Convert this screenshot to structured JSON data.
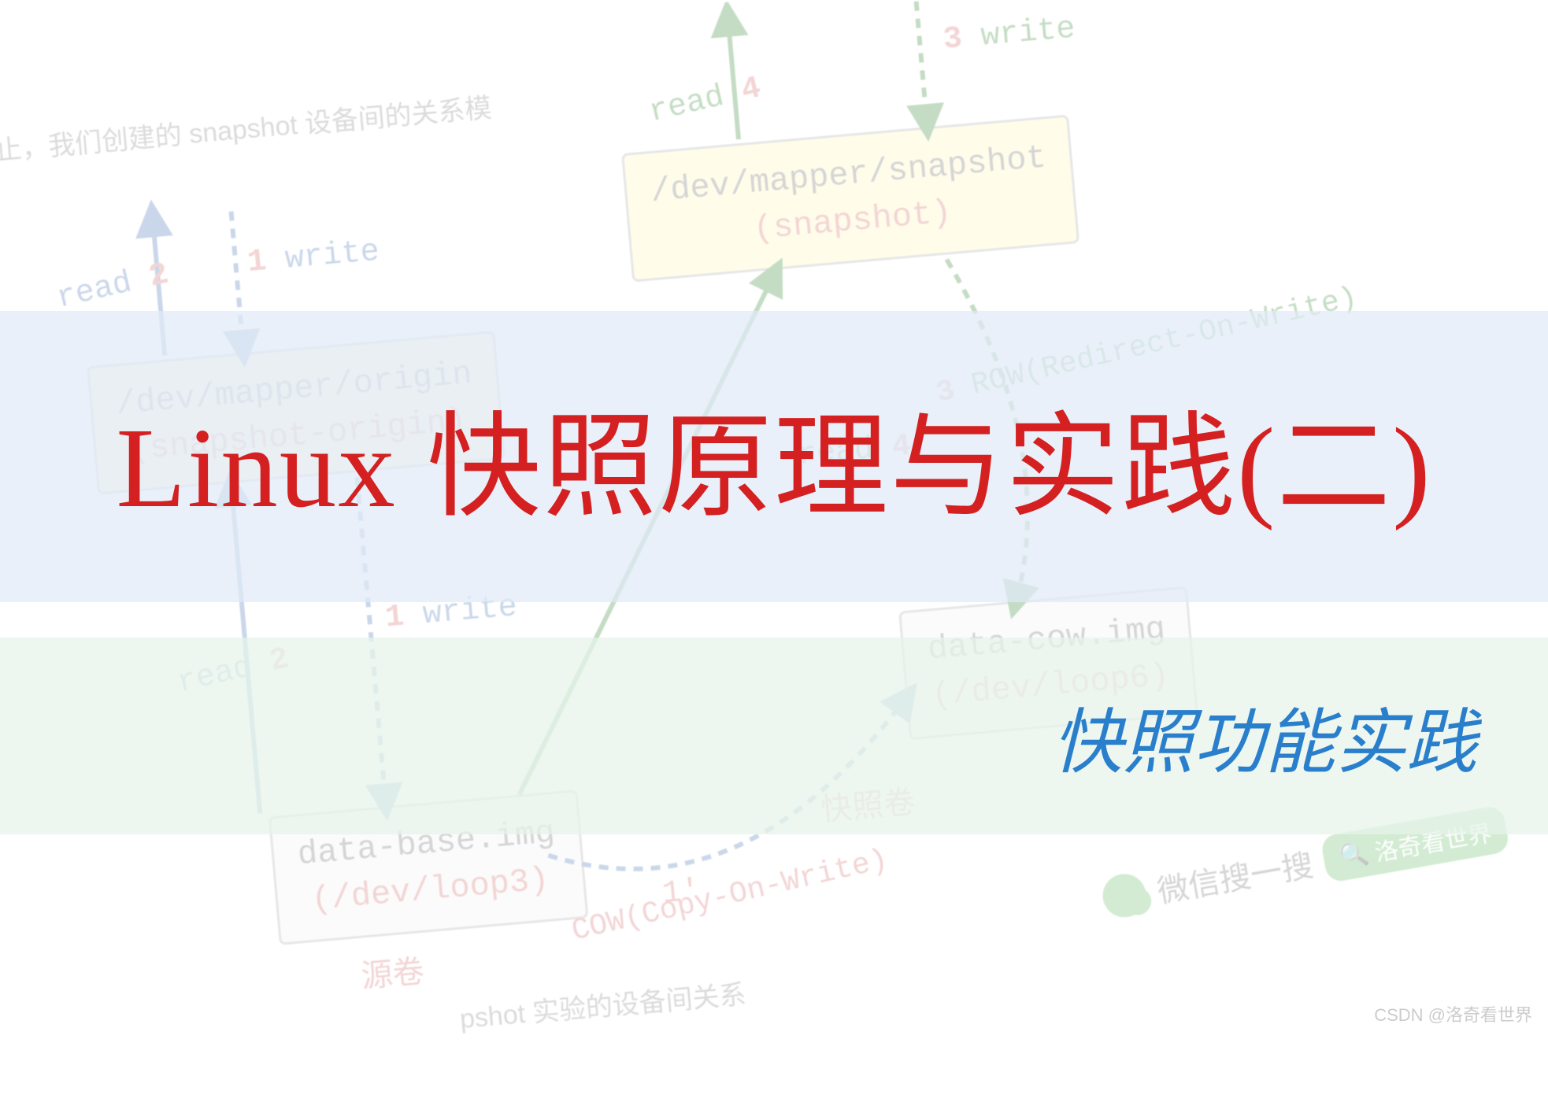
{
  "title": "Linux 快照原理与实践(二)",
  "subtitle": "快照功能实践",
  "caption_top": "此为止，我们创建的 snapshot 设备间的关系模",
  "caption_bottom": "pshot 实验的设备间关系",
  "watermark": "CSDN @洛奇看世界",
  "boxes": {
    "origin": {
      "path": "/dev/mapper/origin",
      "type": "(snapshot-origin)"
    },
    "snapshot": {
      "path": "/dev/mapper/snapshot",
      "type": "(snapshot)"
    },
    "base": {
      "path": "data-base.img",
      "type": "(/dev/loop3)"
    },
    "cow": {
      "path": "data-cow.img",
      "type": "(/dev/loop6)"
    }
  },
  "arrows": {
    "left_top_read": "read",
    "left_top_read_num": "2",
    "left_top_write": "write",
    "left_top_write_num": "1",
    "right_top_read": "read",
    "right_top_read_num": "4",
    "right_top_write": "write",
    "right_top_write_num": "3",
    "left_bot_read": "read",
    "left_bot_read_num": "2",
    "left_bot_write": "write",
    "left_bot_write_num": "1",
    "mid_read": "read",
    "mid_read_num": "4'",
    "prime1": "1'"
  },
  "labels": {
    "cow": "COW(Copy-On-Write)",
    "row": "ROW(Redirect-On-Write)",
    "row_num": "3",
    "source_vol": "源卷",
    "snap_vol": "快照卷"
  },
  "wechat": {
    "search": "微信搜一搜",
    "pill": "洛奇看世界"
  }
}
